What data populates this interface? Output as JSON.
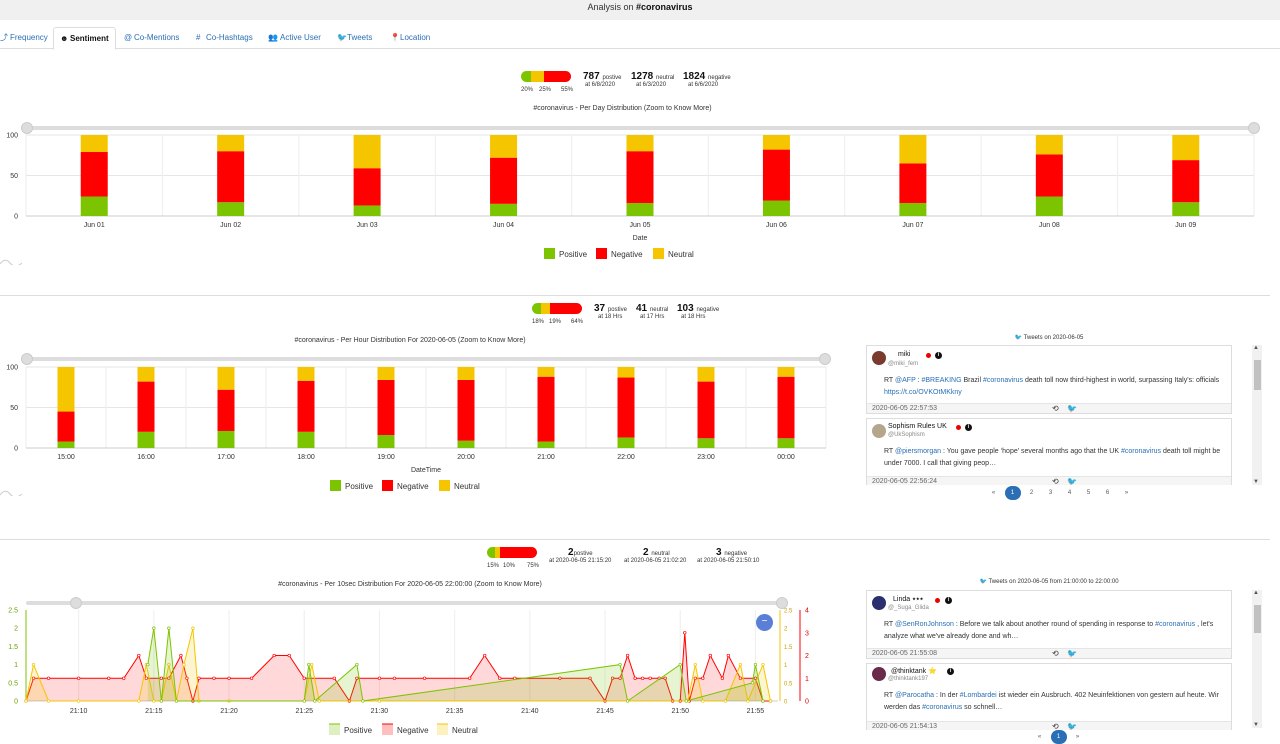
{
  "title_prefix": "Analysis on ",
  "title_tag": "#coronavirus",
  "tabs": [
    {
      "label": "Frequency",
      "icon": "trend-icon"
    },
    {
      "label": "Sentiment",
      "icon": "smile-icon"
    },
    {
      "label": "Co-Mentions",
      "icon": "at-icon"
    },
    {
      "label": "Co-Hashtags",
      "icon": "hash-icon"
    },
    {
      "label": "Active User",
      "icon": "users-icon"
    },
    {
      "label": "Tweets",
      "icon": "twitter-icon"
    },
    {
      "label": "Location",
      "icon": "pin-icon"
    }
  ],
  "colors": {
    "positive": "#7cc400",
    "negative": "#ff0000",
    "neutral": "#f5c600",
    "accent": "#2a6fb5"
  },
  "section1": {
    "bar": {
      "positive_pct": "20%",
      "neutral_pct": "25%",
      "negative_pct": "55%",
      "fractions": [
        0.2,
        0.25,
        0.55
      ]
    },
    "stats": [
      {
        "num": "787",
        "label": "postive",
        "sub": "at 6/8/2020"
      },
      {
        "num": "1278",
        "label": "neutral",
        "sub": "at 6/3/2020"
      },
      {
        "num": "1824",
        "label": "negative",
        "sub": "at 6/6/2020"
      }
    ]
  },
  "section2": {
    "bar": {
      "positive_pct": "18%",
      "neutral_pct": "19%",
      "negative_pct": "64%",
      "fractions": [
        0.18,
        0.19,
        0.64
      ]
    },
    "stats": [
      {
        "num": "37",
        "label": "postive",
        "sub": "at 18 Hrs"
      },
      {
        "num": "41",
        "label": "neutral",
        "sub": "at 17 Hrs"
      },
      {
        "num": "103",
        "label": "negative",
        "sub": "at 18 Hrs"
      }
    ],
    "tweets_header": "Tweets on 2020-06-05",
    "tweets": [
      {
        "name": "miki",
        "handle": "@miki_fem",
        "text_parts": [
          [
            "t",
            "RT "
          ],
          [
            "a",
            "@AFP"
          ],
          [
            "t",
            " : "
          ],
          [
            "a",
            "#BREAKING"
          ],
          [
            "t",
            " Brazil "
          ],
          [
            "a",
            "#coronavirus"
          ],
          [
            "t",
            " death toll now third-highest in world, surpassing Italy's: officials "
          ],
          [
            "a",
            "https://t.co/OVKOtMKkny"
          ]
        ],
        "date": "2020-06-05 22:57:53"
      },
      {
        "name": "Sophism Rules UK",
        "handle": "@UkSophism",
        "text_parts": [
          [
            "t",
            "RT "
          ],
          [
            "a",
            "@piersmorgan"
          ],
          [
            "t",
            " : You gave people ‘hope’ several months ago that the UK "
          ],
          [
            "a",
            "#coronavirus"
          ],
          [
            "t",
            " death toll might be under 7000. I call that giving peop…"
          ]
        ],
        "date": "2020-06-05 22:56:24"
      }
    ],
    "pager": [
      "«",
      "1",
      "2",
      "3",
      "4",
      "5",
      "6",
      "»"
    ]
  },
  "section3": {
    "bar": {
      "positive_pct": "15%",
      "neutral_pct": "10%",
      "negative_pct": "75%",
      "fractions": [
        0.15,
        0.1,
        0.75
      ]
    },
    "stats": [
      {
        "num": "2",
        "label": "postive",
        "sub": "at 2020-06-05 21:15:20"
      },
      {
        "num": "2",
        "label": "neutral",
        "sub": "at 2020-06-05 21:02:20"
      },
      {
        "num": "3",
        "label": "negative",
        "sub": "at 2020-06-05 21:50:10"
      }
    ],
    "tweets_header": "Tweets on 2020-06-05 from 21:00:00 to 22:00:00",
    "tweets": [
      {
        "name": "Linda ⭑⭑⭑",
        "handle": "@_Suga_Glida",
        "text_parts": [
          [
            "t",
            "RT "
          ],
          [
            "a",
            "@SenRonJohnson"
          ],
          [
            "t",
            " : Before we talk about another round of spending in response to "
          ],
          [
            "a",
            "#coronavirus"
          ],
          [
            "t",
            " , let's analyze what we've already done and wh…"
          ]
        ],
        "date": "2020-06-05 21:55:08"
      },
      {
        "name": "@thinktank ⭐",
        "handle": "@thinktank197",
        "text_parts": [
          [
            "t",
            "RT "
          ],
          [
            "a",
            "@Parocatha"
          ],
          [
            "t",
            " : In der "
          ],
          [
            "a",
            "#Lombardei"
          ],
          [
            "t",
            " ist wieder ein Ausbruch. 402 Neuinfektionen von gestern auf heute. Wir werden das "
          ],
          [
            "a",
            "#coronavirus"
          ],
          [
            "t",
            " so schnell…"
          ]
        ],
        "date": "2020-06-05 21:54:13"
      }
    ],
    "pager": [
      "«",
      "1",
      "»"
    ]
  },
  "legend": {
    "positive": "Positive",
    "negative": "Negative",
    "neutral": "Neutral"
  },
  "chart_data": [
    {
      "type": "bar",
      "title": "#coronavirus - Per Day Distribution (Zoom to Know More)",
      "xlabel": "Date",
      "ylabel": "",
      "ylim": [
        0,
        100
      ],
      "yticks": [
        "0",
        "50",
        "100"
      ],
      "categories": [
        "Jun 01",
        "Jun 02",
        "Jun 03",
        "Jun 04",
        "Jun 05",
        "Jun 06",
        "Jun 07",
        "Jun 08",
        "Jun 09"
      ],
      "series": [
        {
          "name": "Positive",
          "values": [
            24,
            17,
            13,
            15,
            16,
            19,
            16,
            24,
            17
          ]
        },
        {
          "name": "Negative",
          "values": [
            55,
            63,
            46,
            57,
            64,
            63,
            49,
            52,
            52
          ]
        },
        {
          "name": "Neutral",
          "values": [
            21,
            20,
            41,
            28,
            20,
            18,
            35,
            24,
            31
          ]
        }
      ],
      "stacked": true,
      "legend": "bottom"
    },
    {
      "type": "bar",
      "title": "#coronavirus - Per Hour Distribution For 2020-06-05 (Zoom to Know More)",
      "xlabel": "DateTime",
      "ylabel": "",
      "ylim": [
        0,
        100
      ],
      "yticks": [
        "0",
        "50",
        "100"
      ],
      "categories": [
        "15:00",
        "16:00",
        "17:00",
        "18:00",
        "19:00",
        "20:00",
        "21:00",
        "22:00",
        "23:00",
        "00:00"
      ],
      "series": [
        {
          "name": "Positive",
          "values": [
            8,
            20,
            21,
            20,
            16,
            9,
            8,
            13,
            12,
            12
          ]
        },
        {
          "name": "Negative",
          "values": [
            37,
            62,
            51,
            63,
            68,
            75,
            80,
            74,
            70,
            76
          ]
        },
        {
          "name": "Neutral",
          "values": [
            55,
            18,
            28,
            17,
            16,
            16,
            12,
            13,
            18,
            12
          ]
        }
      ],
      "stacked": true,
      "legend": "bottom"
    },
    {
      "type": "area",
      "title": "#coronavirus - Per 10sec Distribution For 2020-06-05 22:00:00 (Zoom to Know More)",
      "xlabel": "",
      "ylabel": "",
      "x_start_minute": 6.5,
      "x_end_minute": 56.5,
      "xticks": [
        "21:10",
        "21:15",
        "21:20",
        "21:25",
        "21:30",
        "21:35",
        "21:40",
        "21:45",
        "21:50",
        "21:55"
      ],
      "ylim_left": [
        0,
        2.5
      ],
      "yticks_left": [
        "0",
        "0.5",
        "1",
        "1.5",
        "2",
        "2.5"
      ],
      "ylim_right_pos": [
        0,
        2.5
      ],
      "ylim_right_neg": [
        0,
        4
      ],
      "yticks_right_neg": [
        "0",
        "1",
        "2",
        "3",
        "4"
      ],
      "series": [
        {
          "name": "Positive",
          "points": [
            [
              14.6,
              1
            ],
            [
              15.0,
              2
            ],
            [
              15.5,
              0
            ],
            [
              16.0,
              2
            ],
            [
              16.5,
              0
            ],
            [
              25.0,
              0
            ],
            [
              25.3,
              1
            ],
            [
              25.7,
              0
            ],
            [
              28.5,
              1
            ],
            [
              28.9,
              0
            ],
            [
              46.0,
              1
            ],
            [
              46.5,
              0
            ],
            [
              50.0,
              1
            ],
            [
              50.4,
              0
            ],
            [
              54.8,
              0.5
            ],
            [
              55.0,
              1
            ],
            [
              55.5,
              0
            ]
          ]
        },
        {
          "name": "Negative",
          "points": [
            [
              6.5,
              0
            ],
            [
              7.0,
              1
            ],
            [
              8.0,
              1
            ],
            [
              10.0,
              1
            ],
            [
              12.0,
              1
            ],
            [
              13.0,
              1
            ],
            [
              14.0,
              2
            ],
            [
              14.5,
              1
            ],
            [
              15.5,
              1
            ],
            [
              16.0,
              1
            ],
            [
              16.8,
              2
            ],
            [
              17.2,
              1
            ],
            [
              17.6,
              0
            ],
            [
              18.0,
              1
            ],
            [
              19.0,
              1
            ],
            [
              20.0,
              1
            ],
            [
              21.5,
              1
            ],
            [
              23.0,
              2
            ],
            [
              24.0,
              2
            ],
            [
              25.0,
              1
            ],
            [
              27.0,
              1
            ],
            [
              28.0,
              0
            ],
            [
              28.5,
              1
            ],
            [
              30.0,
              1
            ],
            [
              31.0,
              1
            ],
            [
              33.0,
              1
            ],
            [
              36.0,
              1
            ],
            [
              37.0,
              2
            ],
            [
              38.0,
              1
            ],
            [
              39.0,
              1
            ],
            [
              42.0,
              1
            ],
            [
              44.0,
              1
            ],
            [
              45.0,
              0
            ],
            [
              45.5,
              1
            ],
            [
              46.0,
              1
            ],
            [
              46.5,
              2
            ],
            [
              47.0,
              1
            ],
            [
              47.5,
              1
            ],
            [
              48.0,
              1
            ],
            [
              48.6,
              1
            ],
            [
              49.0,
              1
            ],
            [
              49.5,
              0
            ],
            [
              50.0,
              0
            ],
            [
              50.3,
              3
            ],
            [
              50.6,
              0
            ],
            [
              51.0,
              1
            ],
            [
              51.5,
              1
            ],
            [
              52.0,
              2
            ],
            [
              52.8,
              1
            ],
            [
              53.2,
              2
            ],
            [
              54.0,
              1
            ],
            [
              55.0,
              1
            ],
            [
              55.5,
              0
            ],
            [
              56.0,
              0
            ]
          ]
        },
        {
          "name": "Neutral",
          "points": [
            [
              6.5,
              0
            ],
            [
              7.0,
              1
            ],
            [
              8.0,
              0
            ],
            [
              10.0,
              0
            ],
            [
              14.0,
              0
            ],
            [
              14.5,
              1
            ],
            [
              15.0,
              0
            ],
            [
              15.5,
              0
            ],
            [
              16.0,
              1
            ],
            [
              16.5,
              0
            ],
            [
              17.0,
              1
            ],
            [
              17.6,
              2
            ],
            [
              18.0,
              0
            ],
            [
              20.0,
              0
            ],
            [
              25.0,
              0
            ],
            [
              25.5,
              1
            ],
            [
              26.0,
              0
            ],
            [
              30.0,
              0
            ],
            [
              50.5,
              0
            ],
            [
              51.0,
              1
            ],
            [
              51.5,
              0
            ],
            [
              53.0,
              0
            ],
            [
              54.0,
              1
            ],
            [
              54.5,
              0
            ],
            [
              55.5,
              1
            ],
            [
              56.0,
              0
            ]
          ]
        }
      ],
      "legend": "bottom"
    }
  ]
}
